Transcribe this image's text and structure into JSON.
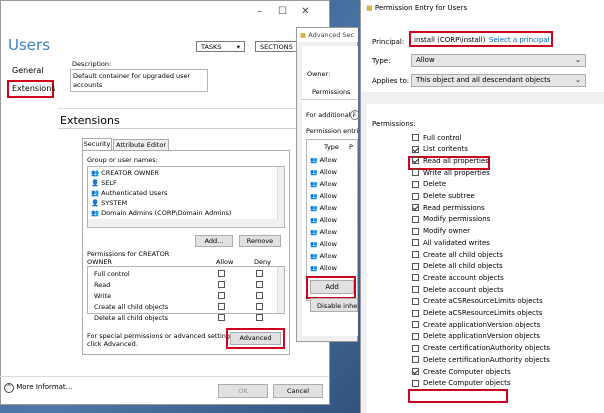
{
  "users_window": {
    "title": "Users",
    "tasks_label": "TASKS",
    "sections_label": "SECTIONS",
    "nav": [
      "General",
      "Extensions"
    ],
    "description_label": "Description:",
    "description_value": "Default container for upgraded user accounts",
    "extensions_title": "Extensions",
    "tabs": [
      "Security",
      "Attribute Editor"
    ],
    "group_label": "Group or user names:",
    "principals": [
      "CREATOR OWNER",
      "SELF",
      "Authenticated Users",
      "SYSTEM",
      "Domain Admins (CORP\\Domain Admins)"
    ],
    "add_label": "Add...",
    "remove_label": "Remove",
    "perm_label_1": "Permissions for CREATOR",
    "perm_label_2": "OWNER",
    "allow_header": "Allow",
    "deny_header": "Deny",
    "perms": [
      "Full control",
      "Read",
      "Write",
      "Create all child objects",
      "Delete all child objects"
    ],
    "special_note_1": "For special permissions or advanced settings,",
    "special_note_2": "click Advanced.",
    "advanced_label": "Advanced",
    "more_info_label": "More Informat...",
    "ok_label": "OK",
    "cancel_label": "Cancel"
  },
  "advanced_window": {
    "title": "Advanced Sec",
    "owner_label": "Owner:",
    "permissions_tab": "Permissions",
    "info_text": "For additional i",
    "entries_label": "Permission entri",
    "type_header": "Type",
    "p_header": "P",
    "rows": [
      "Allow",
      "Allow",
      "Allow",
      "Allow",
      "Allow",
      "Allow",
      "Allow",
      "Allow",
      "Allow",
      "Allow"
    ],
    "add_label": "Add",
    "disable_label": "Disable inhe"
  },
  "permission_entry": {
    "title": "Permission Entry for Users",
    "principal_label": "Principal:",
    "principal_value": "install (CORP\\install)",
    "select_principal_label": "Select a principal",
    "type_label": "Type:",
    "type_value": "Allow",
    "applies_label": "Applies to:",
    "applies_value": "This object and all descendant objects",
    "permissions_label": "Permissions:",
    "permissions": [
      {
        "label": "Full control",
        "checked": false
      },
      {
        "label": "List contents",
        "checked": true
      },
      {
        "label": "Read all properties",
        "checked": true
      },
      {
        "label": "Write all properties",
        "checked": false
      },
      {
        "label": "Delete",
        "checked": false
      },
      {
        "label": "Delete subtree",
        "checked": false
      },
      {
        "label": "Read permissions",
        "checked": true
      },
      {
        "label": "Modify permissions",
        "checked": false
      },
      {
        "label": "Modify owner",
        "checked": false
      },
      {
        "label": "All validated writes",
        "checked": false
      },
      {
        "label": "Create all child objects",
        "checked": false
      },
      {
        "label": "Delete all child objects",
        "checked": false
      },
      {
        "label": "Create account objects",
        "checked": false
      },
      {
        "label": "Delete account objects",
        "checked": false
      },
      {
        "label": "Create aCSResourceLimits objects",
        "checked": false
      },
      {
        "label": "Delete aCSResourceLimits objects",
        "checked": false
      },
      {
        "label": "Create applicationVersion objects",
        "checked": false
      },
      {
        "label": "Delete applicationVersion objects",
        "checked": false
      },
      {
        "label": "Create certificationAuthority objects",
        "checked": false
      },
      {
        "label": "Delete certificationAuthority objects",
        "checked": false
      },
      {
        "label": "Create Computer objects",
        "checked": true
      },
      {
        "label": "Delete Computer objects",
        "checked": false
      }
    ]
  }
}
